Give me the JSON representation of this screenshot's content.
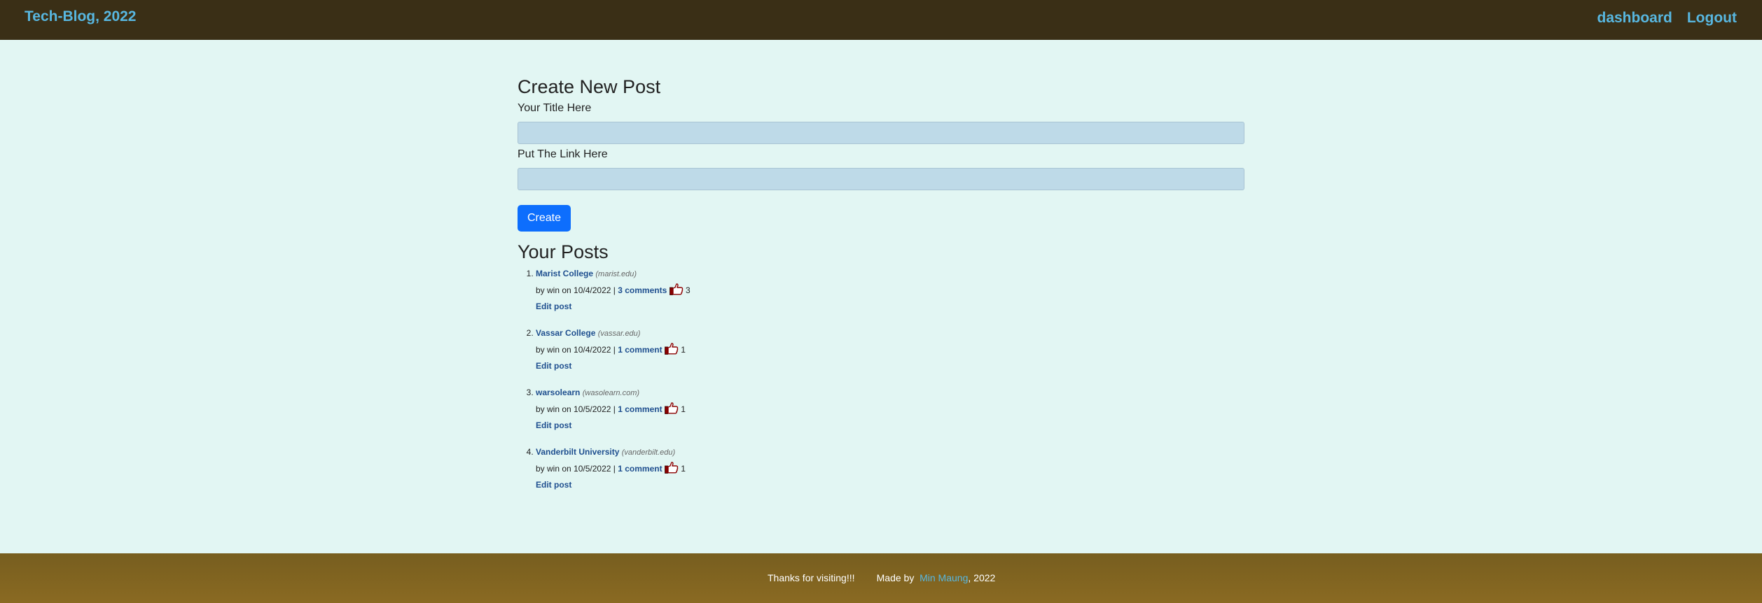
{
  "header": {
    "brand": "Tech-Blog, 2022",
    "nav": [
      "dashboard",
      "Logout"
    ]
  },
  "create_form": {
    "heading": "Create New Post",
    "title_label": "Your Title Here",
    "title_value": "",
    "link_label": "Put The Link Here",
    "link_value": "",
    "submit_label": "Create"
  },
  "posts_heading": "Your Posts",
  "posts": [
    {
      "title": "Marist College",
      "domain": "(marist.edu)",
      "meta": "by win on 10/4/2022 |",
      "comments": "3 comments",
      "likes": "3",
      "edit": "Edit post"
    },
    {
      "title": "Vassar College",
      "domain": "(vassar.edu)",
      "meta": "by win on 10/4/2022 |",
      "comments": "1 comment",
      "likes": "1",
      "edit": "Edit post"
    },
    {
      "title": "warsolearn",
      "domain": "(wasolearn.com)",
      "meta": "by win on 10/5/2022 |",
      "comments": "1 comment",
      "likes": "1",
      "edit": "Edit post"
    },
    {
      "title": "Vanderbilt University",
      "domain": "(vanderbilt.edu)",
      "meta": "by win on 10/5/2022 |",
      "comments": "1 comment",
      "likes": "1",
      "edit": "Edit post"
    }
  ],
  "footer": {
    "thanks": "Thanks for visiting!!!",
    "made_by": "Made by ",
    "author": "Min Maung",
    "year": ", 2022"
  },
  "icons": {
    "like": "thumbs-up-icon"
  },
  "colors": {
    "header_bg": "#3a2f16",
    "link": "#58b7e0",
    "page_bg": "#e2f6f3",
    "button": "#0d6efd",
    "footer": "#8a6a22"
  }
}
